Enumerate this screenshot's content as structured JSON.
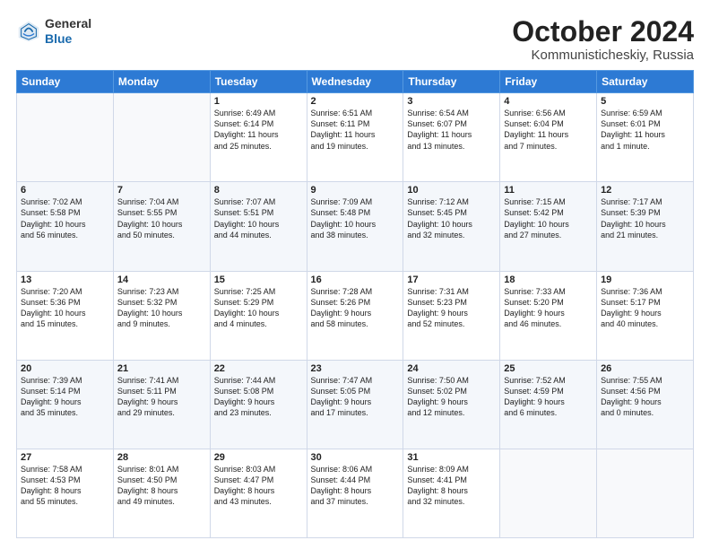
{
  "header": {
    "logo_general": "General",
    "logo_blue": "Blue",
    "month": "October 2024",
    "location": "Kommunisticheskiy, Russia"
  },
  "weekdays": [
    "Sunday",
    "Monday",
    "Tuesday",
    "Wednesday",
    "Thursday",
    "Friday",
    "Saturday"
  ],
  "weeks": [
    [
      {
        "day": "",
        "content": ""
      },
      {
        "day": "",
        "content": ""
      },
      {
        "day": "1",
        "content": "Sunrise: 6:49 AM\nSunset: 6:14 PM\nDaylight: 11 hours\nand 25 minutes."
      },
      {
        "day": "2",
        "content": "Sunrise: 6:51 AM\nSunset: 6:11 PM\nDaylight: 11 hours\nand 19 minutes."
      },
      {
        "day": "3",
        "content": "Sunrise: 6:54 AM\nSunset: 6:07 PM\nDaylight: 11 hours\nand 13 minutes."
      },
      {
        "day": "4",
        "content": "Sunrise: 6:56 AM\nSunset: 6:04 PM\nDaylight: 11 hours\nand 7 minutes."
      },
      {
        "day": "5",
        "content": "Sunrise: 6:59 AM\nSunset: 6:01 PM\nDaylight: 11 hours\nand 1 minute."
      }
    ],
    [
      {
        "day": "6",
        "content": "Sunrise: 7:02 AM\nSunset: 5:58 PM\nDaylight: 10 hours\nand 56 minutes."
      },
      {
        "day": "7",
        "content": "Sunrise: 7:04 AM\nSunset: 5:55 PM\nDaylight: 10 hours\nand 50 minutes."
      },
      {
        "day": "8",
        "content": "Sunrise: 7:07 AM\nSunset: 5:51 PM\nDaylight: 10 hours\nand 44 minutes."
      },
      {
        "day": "9",
        "content": "Sunrise: 7:09 AM\nSunset: 5:48 PM\nDaylight: 10 hours\nand 38 minutes."
      },
      {
        "day": "10",
        "content": "Sunrise: 7:12 AM\nSunset: 5:45 PM\nDaylight: 10 hours\nand 32 minutes."
      },
      {
        "day": "11",
        "content": "Sunrise: 7:15 AM\nSunset: 5:42 PM\nDaylight: 10 hours\nand 27 minutes."
      },
      {
        "day": "12",
        "content": "Sunrise: 7:17 AM\nSunset: 5:39 PM\nDaylight: 10 hours\nand 21 minutes."
      }
    ],
    [
      {
        "day": "13",
        "content": "Sunrise: 7:20 AM\nSunset: 5:36 PM\nDaylight: 10 hours\nand 15 minutes."
      },
      {
        "day": "14",
        "content": "Sunrise: 7:23 AM\nSunset: 5:32 PM\nDaylight: 10 hours\nand 9 minutes."
      },
      {
        "day": "15",
        "content": "Sunrise: 7:25 AM\nSunset: 5:29 PM\nDaylight: 10 hours\nand 4 minutes."
      },
      {
        "day": "16",
        "content": "Sunrise: 7:28 AM\nSunset: 5:26 PM\nDaylight: 9 hours\nand 58 minutes."
      },
      {
        "day": "17",
        "content": "Sunrise: 7:31 AM\nSunset: 5:23 PM\nDaylight: 9 hours\nand 52 minutes."
      },
      {
        "day": "18",
        "content": "Sunrise: 7:33 AM\nSunset: 5:20 PM\nDaylight: 9 hours\nand 46 minutes."
      },
      {
        "day": "19",
        "content": "Sunrise: 7:36 AM\nSunset: 5:17 PM\nDaylight: 9 hours\nand 40 minutes."
      }
    ],
    [
      {
        "day": "20",
        "content": "Sunrise: 7:39 AM\nSunset: 5:14 PM\nDaylight: 9 hours\nand 35 minutes."
      },
      {
        "day": "21",
        "content": "Sunrise: 7:41 AM\nSunset: 5:11 PM\nDaylight: 9 hours\nand 29 minutes."
      },
      {
        "day": "22",
        "content": "Sunrise: 7:44 AM\nSunset: 5:08 PM\nDaylight: 9 hours\nand 23 minutes."
      },
      {
        "day": "23",
        "content": "Sunrise: 7:47 AM\nSunset: 5:05 PM\nDaylight: 9 hours\nand 17 minutes."
      },
      {
        "day": "24",
        "content": "Sunrise: 7:50 AM\nSunset: 5:02 PM\nDaylight: 9 hours\nand 12 minutes."
      },
      {
        "day": "25",
        "content": "Sunrise: 7:52 AM\nSunset: 4:59 PM\nDaylight: 9 hours\nand 6 minutes."
      },
      {
        "day": "26",
        "content": "Sunrise: 7:55 AM\nSunset: 4:56 PM\nDaylight: 9 hours\nand 0 minutes."
      }
    ],
    [
      {
        "day": "27",
        "content": "Sunrise: 7:58 AM\nSunset: 4:53 PM\nDaylight: 8 hours\nand 55 minutes."
      },
      {
        "day": "28",
        "content": "Sunrise: 8:01 AM\nSunset: 4:50 PM\nDaylight: 8 hours\nand 49 minutes."
      },
      {
        "day": "29",
        "content": "Sunrise: 8:03 AM\nSunset: 4:47 PM\nDaylight: 8 hours\nand 43 minutes."
      },
      {
        "day": "30",
        "content": "Sunrise: 8:06 AM\nSunset: 4:44 PM\nDaylight: 8 hours\nand 37 minutes."
      },
      {
        "day": "31",
        "content": "Sunrise: 8:09 AM\nSunset: 4:41 PM\nDaylight: 8 hours\nand 32 minutes."
      },
      {
        "day": "",
        "content": ""
      },
      {
        "day": "",
        "content": ""
      }
    ]
  ]
}
